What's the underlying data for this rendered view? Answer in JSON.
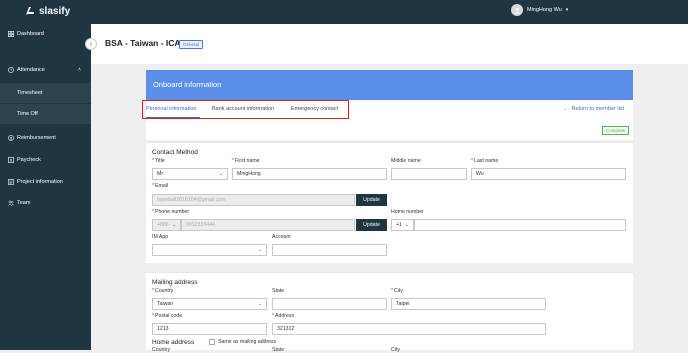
{
  "app": {
    "logo_text": "slasify"
  },
  "user": {
    "name": "MingHong Wu"
  },
  "sidebar": {
    "items": [
      {
        "label": "Dashboard"
      },
      {
        "label": "Attendance"
      },
      {
        "label": "Timesheet"
      },
      {
        "label": "Time Off"
      },
      {
        "label": "Reimbursement"
      },
      {
        "label": "Paycheck"
      },
      {
        "label": "Project information"
      },
      {
        "label": "Team"
      }
    ]
  },
  "header": {
    "title": "BSA - Taiwan - ICA",
    "badge": "General"
  },
  "banner": {
    "title": "Onboard information"
  },
  "tabs": [
    {
      "label": "Personal information"
    },
    {
      "label": "Bank account information"
    },
    {
      "label": "Emergency contact"
    }
  ],
  "return_link": "Return to member list",
  "status_badge": "Complete",
  "contact": {
    "title": "Contact Method",
    "title_label": "Title",
    "title_value": "Mr",
    "first_name_label": "First name",
    "first_name_value": "MingHong",
    "middle_name_label": "Middle name",
    "middle_name_value": "",
    "last_name_label": "Last name",
    "last_name_value": "Wu",
    "email_label": "Email",
    "email_value": "baseball2016104@gmail.com",
    "update_label": "Update",
    "phone_label": "Phone number",
    "phone_code": "+886",
    "phone_value": "0912333444",
    "home_label": "Home number",
    "home_code": "+1",
    "home_value": "",
    "im_label": "IM App",
    "im_value": "",
    "account_label": "Account",
    "account_value": ""
  },
  "mailing": {
    "title": "Mailing address",
    "country_label": "Country",
    "country_value": "Taiwan",
    "state_label": "State",
    "state_value": "",
    "city_label": "City",
    "city_value": "Taipei",
    "postal_label": "Postal code",
    "postal_value": "1213",
    "address_label": "Address",
    "address_value": "321312"
  },
  "home": {
    "title": "Home address",
    "same_label": "Same as mailing address",
    "country_label": "Country",
    "state_label": "State",
    "city_label": "City"
  },
  "colors": {
    "sidebar": "#1f3541",
    "banner": "#5b8ee6",
    "accent": "#3e6fd0",
    "highlight": "#e02020",
    "complete": "#5bb05b"
  }
}
